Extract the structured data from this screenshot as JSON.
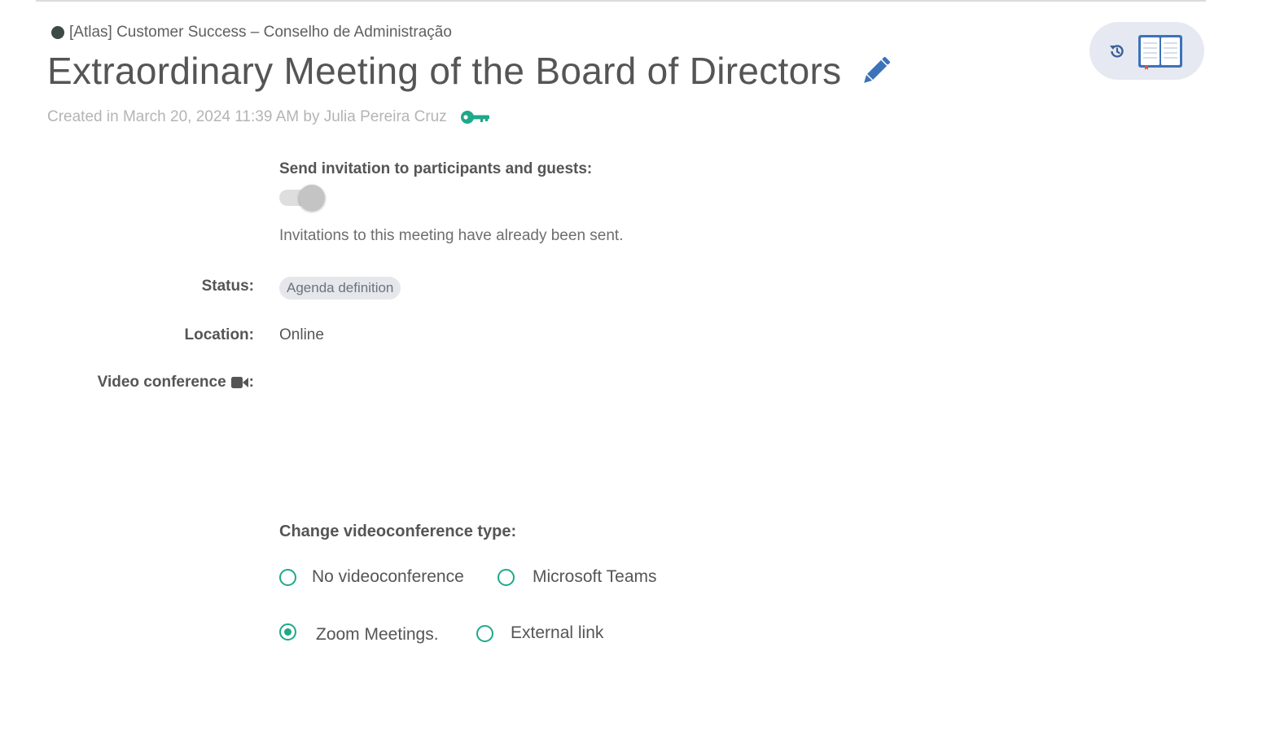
{
  "header": {
    "org_name": "[Atlas] Customer Success – Conselho de Administração",
    "title": "Extraordinary Meeting of the Board of Directors",
    "created_text": "Created in March 20, 2024 11:39 AM by Julia Pereira Cruz",
    "icons": {
      "edit": "pencil-icon",
      "permissions": "key-icon",
      "history": "history-icon",
      "manual": "book-icon"
    }
  },
  "invitation": {
    "label": "Send invitation to participants and guests:",
    "toggle_on": true,
    "note": "Invitations to this meeting have already been sent."
  },
  "details": {
    "status_label": "Status:",
    "status_value": "Agenda definition",
    "location_label": "Location:",
    "location_value": "Online",
    "video_label": "Video conference",
    "video_suffix": ":",
    "video_icon": "video-camera-icon"
  },
  "videoconference": {
    "label": "Change videoconference type:",
    "options": [
      {
        "label": "No videoconference",
        "checked": false
      },
      {
        "label": "Microsoft Teams",
        "checked": false
      },
      {
        "label": "Zoom Meetings.",
        "checked": true
      },
      {
        "label": "External link",
        "checked": false
      }
    ]
  },
  "colors": {
    "accent_teal": "#1fa889",
    "edit_blue": "#3b73b9",
    "badge_bg": "#e5e7eb",
    "actions_bg": "#e6e9f1"
  }
}
